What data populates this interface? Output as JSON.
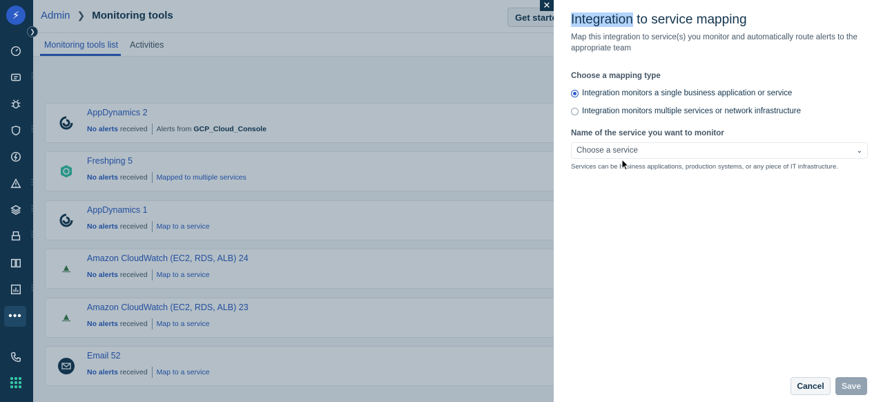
{
  "header": {
    "breadcrumb_admin": "Admin",
    "breadcrumb_current": "Monitoring tools",
    "get_started_label": "Get started"
  },
  "tabs": [
    {
      "label": "Monitoring tools list",
      "active": true
    },
    {
      "label": "Activities",
      "active": false
    }
  ],
  "integrations": [
    {
      "name": "AppDynamics 2",
      "icon": "appdynamics-icon",
      "status_bold": "No alerts",
      "status_rest": "received",
      "detail_prefix": "Alerts from",
      "detail_value": "GCP_Cloud_Console",
      "detail_link": ""
    },
    {
      "name": "Freshping 5",
      "icon": "freshping-icon",
      "status_bold": "No alerts",
      "status_rest": "received",
      "detail_prefix": "",
      "detail_value": "",
      "detail_link": "Mapped to multiple services"
    },
    {
      "name": "AppDynamics 1",
      "icon": "appdynamics-icon",
      "status_bold": "No alerts",
      "status_rest": "received",
      "detail_prefix": "",
      "detail_value": "",
      "detail_link": "Map to a service"
    },
    {
      "name": "Amazon CloudWatch (EC2, RDS, ALB) 24",
      "icon": "cloudwatch-icon",
      "status_bold": "No alerts",
      "status_rest": "received",
      "detail_prefix": "",
      "detail_value": "",
      "detail_link": "Map to a service"
    },
    {
      "name": "Amazon CloudWatch (EC2, RDS, ALB) 23",
      "icon": "cloudwatch-icon",
      "status_bold": "No alerts",
      "status_rest": "received",
      "detail_prefix": "",
      "detail_value": "",
      "detail_link": "Map to a service"
    },
    {
      "name": "Email 52",
      "icon": "email-icon",
      "status_bold": "No alerts",
      "status_rest": "received",
      "detail_prefix": "",
      "detail_value": "",
      "detail_link": "Map to a service"
    }
  ],
  "panel": {
    "title_highlight": "Integration",
    "title_rest": " to service mapping",
    "description": "Map this integration to service(s) you monitor and automatically route alerts to the appropriate team",
    "mapping_type_label": "Choose a mapping type",
    "options": [
      {
        "label": "Integration monitors a single business application or service",
        "checked": true
      },
      {
        "label": "Integration monitors multiple services or network infrastructure",
        "checked": false
      }
    ],
    "service_label": "Name of the service you want to monitor",
    "service_placeholder": "Choose a service",
    "helper_text": "Services can be business applications, production systems, or any piece of IT infrastructure.",
    "cancel_label": "Cancel",
    "save_label": "Save",
    "close_symbol": "✕"
  },
  "nav_icons": [
    "dashboard-icon",
    "tickets-icon",
    "bug-icon",
    "shield-icon",
    "bolt-icon",
    "alert-icon",
    "layers-icon",
    "print-icon",
    "book-icon",
    "analytics-icon",
    "more-icon",
    "phone-icon",
    "apps-icon"
  ],
  "colors": {
    "primary": "#2c5cc5",
    "nav_bg": "#12344d",
    "highlight": "#b3d4fc",
    "accent_green": "#34c3a3"
  }
}
